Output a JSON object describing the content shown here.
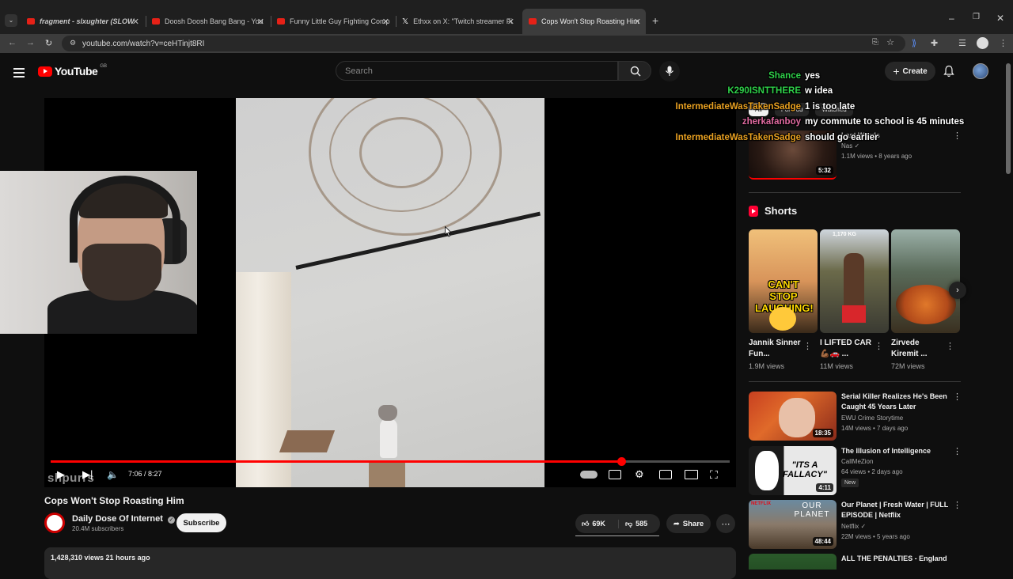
{
  "browser": {
    "tabs": [
      {
        "label": "fragment - slxughter (SLOW",
        "icon": "youtube-icon"
      },
      {
        "label": "Doosh Doosh Bang Bang - You",
        "icon": "youtube-icon"
      },
      {
        "label": "Funny Little Guy Fighting Comp",
        "icon": "youtube-icon"
      },
      {
        "label": "Ethxx on X: \"Twitch streamer Fi",
        "icon": "x-icon"
      },
      {
        "label": "Cops Won't Stop Roasting Him",
        "icon": "youtube-icon"
      }
    ],
    "url": "youtube.com/watch?v=ceHTinjt8RI"
  },
  "youtube": {
    "logo_text": "YouTube",
    "region": "GB",
    "search_placeholder": "Search",
    "create_label": "Create"
  },
  "player": {
    "time": "7:06 / 8:27",
    "progress": 0.84,
    "watermark": "shpurrs"
  },
  "video": {
    "title": "Cops Won't Stop Roasting Him",
    "channel": "Daily Dose Of Internet",
    "subscribers": "20.4M subscribers",
    "subscribe_label": "Subscribe",
    "likes": "69K",
    "dislikes": "585",
    "share_label": "Share",
    "views_line": "1,428,310 views  21 hours ago"
  },
  "sidebar": {
    "chips": [
      "All",
      "For You",
      "Watched"
    ],
    "top_rec": {
      "title": "Last Words",
      "channel": "Nas",
      "meta": "1.1M views • 8 years ago",
      "duration": "5:32"
    },
    "shorts_heading": "Shorts",
    "shorts": [
      {
        "title": "Jannik Sinner Fun...",
        "views": "1.9M views",
        "overlay": "CAN'T STOP LAUGHING!"
      },
      {
        "title": "I LIFTED CAR 💪🏾🚗 ...",
        "views": "11M views",
        "overlay": "1,170 KG"
      },
      {
        "title": "Zirvede Kiremit ...",
        "views": "72M views",
        "overlay": ""
      }
    ],
    "recommendations": [
      {
        "title": "Serial Killer Realizes He's Been Caught 45 Years Later",
        "channel": "EWU Crime Storytime",
        "meta": "14M views • 7 days ago",
        "duration": "18:35"
      },
      {
        "title": "The Illusion of Intelligence",
        "channel": "CallMeZion",
        "meta": "64 views • 2 days ago",
        "duration": "4:11",
        "badge": "New",
        "overlay": "\"ITS A FALLACY\""
      },
      {
        "title": "Our Planet | Fresh Water | FULL EPISODE | Netflix",
        "channel": "Netflix",
        "meta": "22M views • 5 years ago",
        "duration": "48:44",
        "overlay": "OUR PLANET"
      },
      {
        "title": "ALL THE PENALTIES - England",
        "channel": "",
        "meta": "",
        "duration": ""
      }
    ]
  },
  "chat": [
    {
      "user": "Shance",
      "color": "#2fd14a",
      "message": "yes"
    },
    {
      "user": "K290ISNTTHERE",
      "color": "#2fd14a",
      "message": "w idea"
    },
    {
      "user": "IntermediateWasTakenSadge",
      "color": "#e8a020",
      "message": "1 is too late"
    },
    {
      "user": "zherkafanboy",
      "color": "#e06aa0",
      "message": "my commute to school is 45 minutes"
    },
    {
      "user": "IntermediateWasTakenSadge",
      "color": "#e8a020",
      "message": "should go earlier"
    }
  ],
  "colors": {
    "youtube_red": "#ff0000",
    "background": "#0f0f0f"
  }
}
